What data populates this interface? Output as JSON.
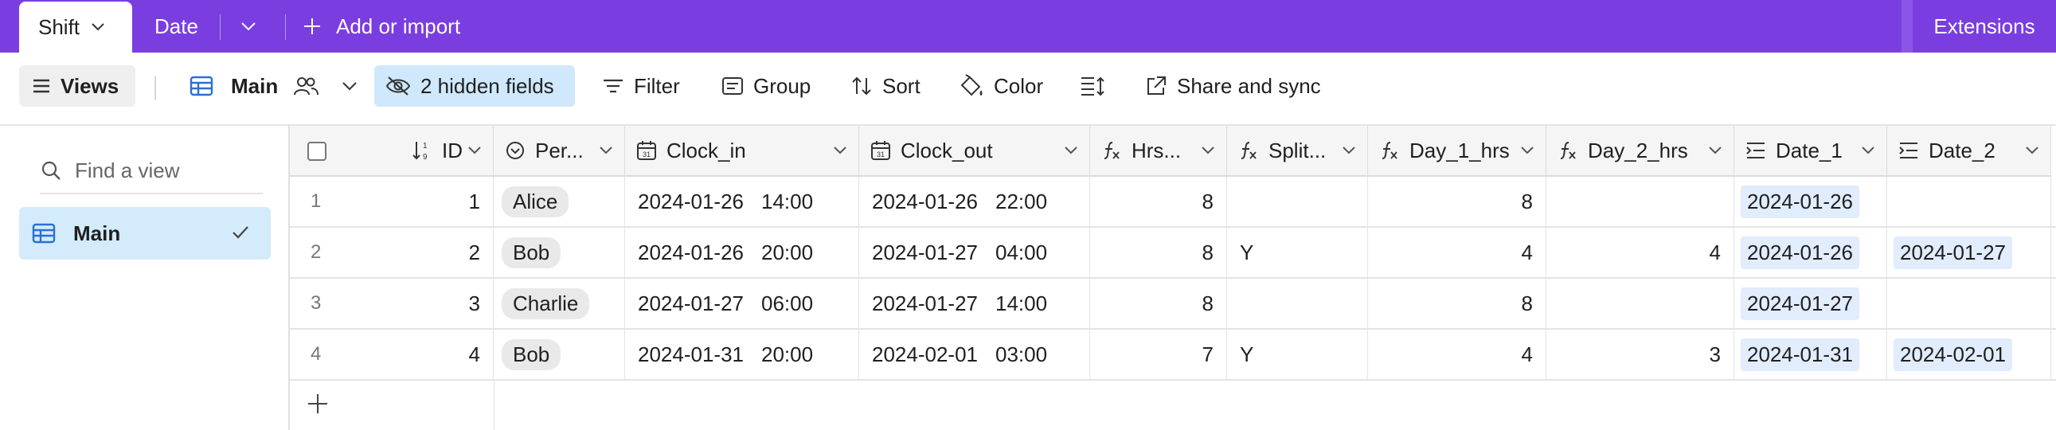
{
  "topbar": {
    "active_tab": "Shift",
    "tab_date": "Date",
    "add_import": "Add or import",
    "extensions": "Extensions"
  },
  "toolbar": {
    "views": "Views",
    "view_name": "Main",
    "hidden_fields": "2 hidden fields",
    "filter": "Filter",
    "group": "Group",
    "sort": "Sort",
    "color": "Color",
    "share_sync": "Share and sync"
  },
  "sidebar": {
    "search_placeholder": "Find a view",
    "views": [
      {
        "label": "Main",
        "selected": true
      }
    ]
  },
  "grid": {
    "columns": [
      {
        "label": "ID",
        "icon": "sort-number-icon"
      },
      {
        "label": "Per...",
        "icon": "single-select-icon"
      },
      {
        "label": "Clock_in",
        "icon": "calendar-icon"
      },
      {
        "label": "Clock_out",
        "icon": "calendar-icon"
      },
      {
        "label": "Hrs...",
        "icon": "formula-icon"
      },
      {
        "label": "Split...",
        "icon": "formula-icon"
      },
      {
        "label": "Day_1_hrs",
        "icon": "formula-icon"
      },
      {
        "label": "Day_2_hrs",
        "icon": "formula-icon"
      },
      {
        "label": "Date_1",
        "icon": "lookup-icon"
      },
      {
        "label": "Date_2",
        "icon": "lookup-icon"
      }
    ],
    "rows": [
      {
        "n": "1",
        "id": "1",
        "person": "Alice",
        "in_d": "2024-01-26",
        "in_t": "14:00",
        "out_d": "2024-01-26",
        "out_t": "22:00",
        "hrs": "8",
        "split": "",
        "d1": "8",
        "d2": "",
        "date1": "2024-01-26",
        "date2": ""
      },
      {
        "n": "2",
        "id": "2",
        "person": "Bob",
        "in_d": "2024-01-26",
        "in_t": "20:00",
        "out_d": "2024-01-27",
        "out_t": "04:00",
        "hrs": "8",
        "split": "Y",
        "d1": "4",
        "d2": "4",
        "date1": "2024-01-26",
        "date2": "2024-01-27"
      },
      {
        "n": "3",
        "id": "3",
        "person": "Charlie",
        "in_d": "2024-01-27",
        "in_t": "06:00",
        "out_d": "2024-01-27",
        "out_t": "14:00",
        "hrs": "8",
        "split": "",
        "d1": "8",
        "d2": "",
        "date1": "2024-01-27",
        "date2": ""
      },
      {
        "n": "4",
        "id": "4",
        "person": "Bob",
        "in_d": "2024-01-31",
        "in_t": "20:00",
        "out_d": "2024-02-01",
        "out_t": "03:00",
        "hrs": "7",
        "split": "Y",
        "d1": "4",
        "d2": "3",
        "date1": "2024-01-31",
        "date2": "2024-02-01"
      }
    ]
  },
  "colors": {
    "topbar": "#7a3ee0",
    "hidden_fields_bg": "#cfe8fb",
    "selected_view_bg": "#d4ebfb",
    "date_pill_bg": "#e1ecfc"
  }
}
